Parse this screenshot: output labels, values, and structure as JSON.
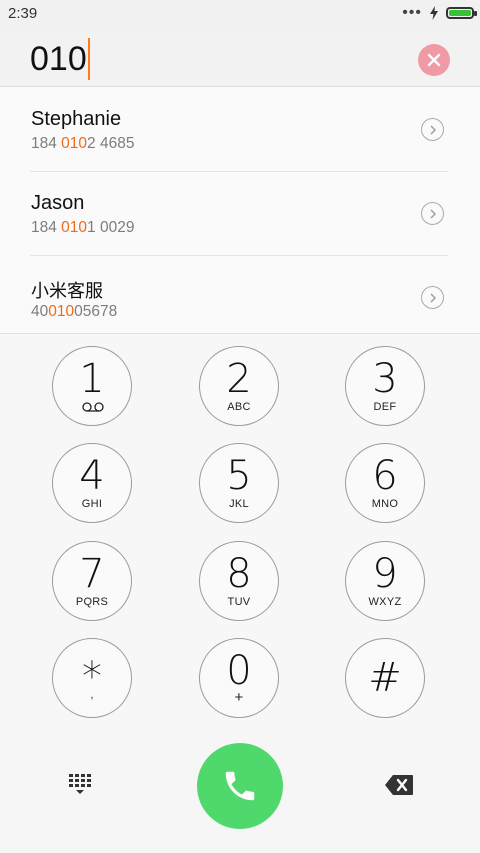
{
  "status_bar": {
    "time": "2:39",
    "more_indicator": "•••",
    "battery_color": "#37c236"
  },
  "input": {
    "value": "010",
    "caret_color": "#ff7a1a",
    "clear_button_color": "#f09aa6"
  },
  "contacts": [
    {
      "name": "Stephanie",
      "number_pre": "184 ",
      "number_match": "010",
      "number_post": "2 4685"
    },
    {
      "name": "Jason",
      "number_pre": "184 ",
      "number_match": "010",
      "number_post": "1 0029"
    },
    {
      "name": "小米客服",
      "number_pre": "40",
      "number_match": "010",
      "number_post": "05678"
    }
  ],
  "keys": [
    {
      "digit": "1",
      "letters": "",
      "icon": "voicemail-icon"
    },
    {
      "digit": "2",
      "letters": "ABC"
    },
    {
      "digit": "3",
      "letters": "DEF"
    },
    {
      "digit": "4",
      "letters": "GHI"
    },
    {
      "digit": "5",
      "letters": "JKL"
    },
    {
      "digit": "6",
      "letters": "MNO"
    },
    {
      "digit": "7",
      "letters": "PQRS"
    },
    {
      "digit": "8",
      "letters": "TUV"
    },
    {
      "digit": "9",
      "letters": "WXYZ"
    },
    {
      "digit": "*",
      "letters": ","
    },
    {
      "digit": "0",
      "letters": "+"
    },
    {
      "digit": "#",
      "letters": ""
    }
  ],
  "bottom": {
    "call_button_color": "#4fd86c",
    "match_highlight_color": "#f06a1a"
  }
}
